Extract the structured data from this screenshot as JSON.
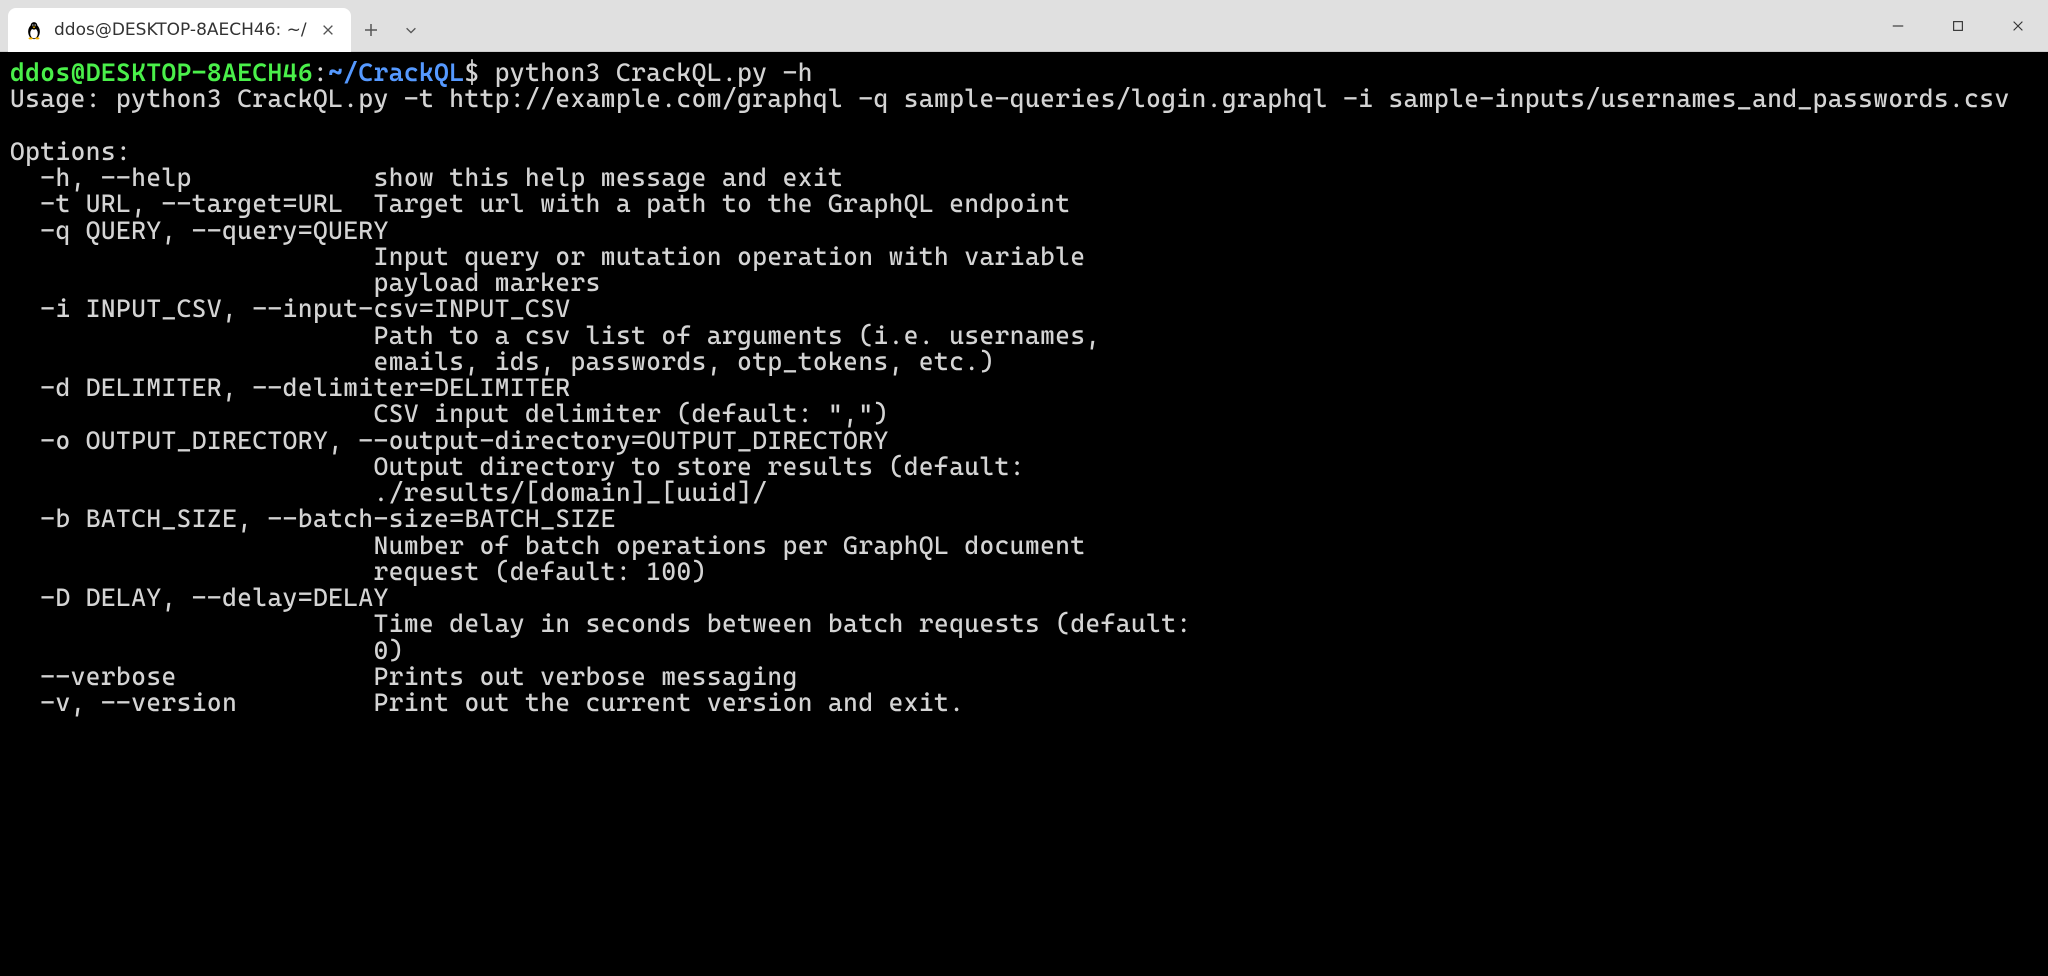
{
  "titlebar": {
    "tab_title": "ddos@DESKTOP-8AECH46: ~/"
  },
  "prompt": {
    "user_host": "ddos@DESKTOP-8AECH46",
    "sep": ":",
    "path": "~/CrackQL",
    "dollar": "$",
    "command": " python3 CrackQL.py -h"
  },
  "output": {
    "usage_line": "Usage: python3 CrackQL.py -t http://example.com/graphql -q sample-queries/login.graphql -i sample-inputs/usernames_and_passwords.csv",
    "blank": "",
    "options_header": "Options:",
    "opt_help": "  -h, --help            show this help message and exit",
    "opt_target": "  -t URL, --target=URL  Target url with a path to the GraphQL endpoint",
    "opt_query1": "  -q QUERY, --query=QUERY",
    "opt_query2": "                        Input query or mutation operation with variable",
    "opt_query3": "                        payload markers",
    "opt_input1": "  -i INPUT_CSV, --input-csv=INPUT_CSV",
    "opt_input2": "                        Path to a csv list of arguments (i.e. usernames,",
    "opt_input3": "                        emails, ids, passwords, otp_tokens, etc.)",
    "opt_delim1": "  -d DELIMITER, --delimiter=DELIMITER",
    "opt_delim2": "                        CSV input delimiter (default: \",\")",
    "opt_out1": "  -o OUTPUT_DIRECTORY, --output-directory=OUTPUT_DIRECTORY",
    "opt_out2": "                        Output directory to store results (default:",
    "opt_out3": "                        ./results/[domain]_[uuid]/",
    "opt_batch1": "  -b BATCH_SIZE, --batch-size=BATCH_SIZE",
    "opt_batch2": "                        Number of batch operations per GraphQL document",
    "opt_batch3": "                        request (default: 100)",
    "opt_delay1": "  -D DELAY, --delay=DELAY",
    "opt_delay2": "                        Time delay in seconds between batch requests (default:",
    "opt_delay3": "                        0)",
    "opt_verbose": "  --verbose             Prints out verbose messaging",
    "opt_version": "  -v, --version         Print out the current version and exit."
  }
}
